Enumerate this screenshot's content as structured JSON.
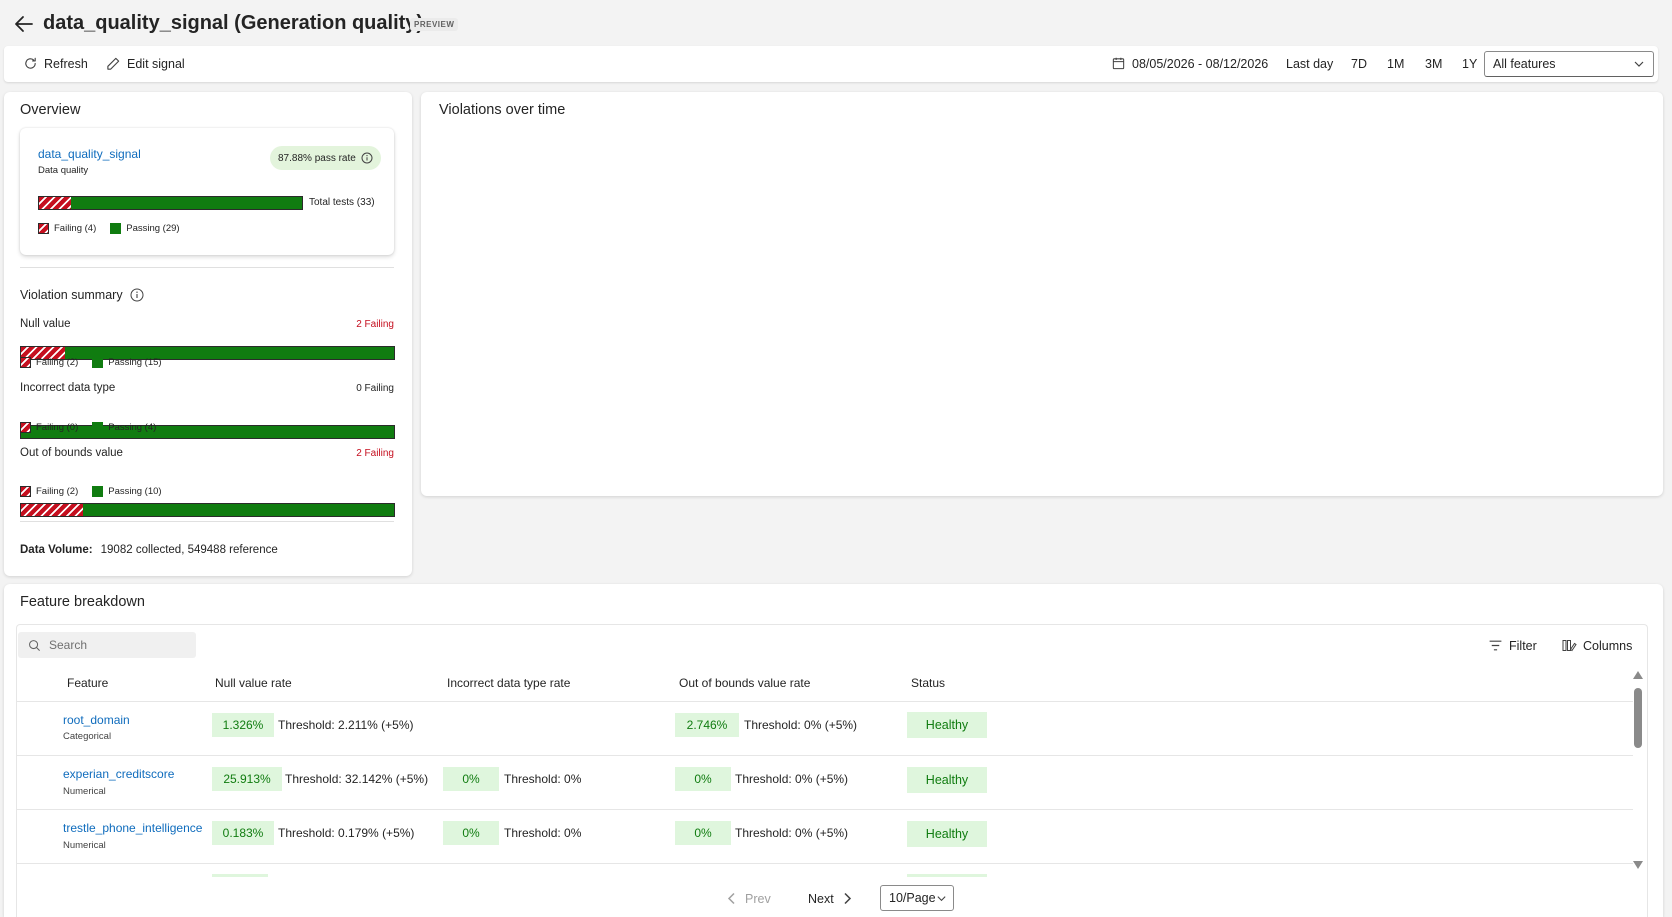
{
  "header": {
    "title": "data_quality_signal (Generation quality)",
    "badge": "PREVIEW"
  },
  "toolbar": {
    "refresh_label": "Refresh",
    "edit_label": "Edit signal",
    "date_range": "08/05/2026 - 08/12/2026",
    "ranges": [
      "Last day",
      "7D",
      "1M",
      "3M",
      "1Y"
    ],
    "feature_filter": "All features"
  },
  "overview": {
    "title": "Overview",
    "signal_name": "data_quality_signal",
    "signal_type": "Data quality",
    "pass_rate_label": "87.88% pass rate",
    "pass_rate": 0.8788,
    "total_tests_label": "Total tests (33)",
    "failing_label": "Failing (4)",
    "passing_label": "Passing (29)",
    "failing": 4,
    "passing": 29
  },
  "violation_summary": {
    "title": "Violation summary",
    "items": [
      {
        "label": "Null value",
        "count_label": "2 Failing",
        "failing_label": "Failing (2)",
        "passing_label": "Passing (15)",
        "failing": 2,
        "passing": 15
      },
      {
        "label": "Incorrect data type",
        "count_label": "0 Failing",
        "failing_label": "Failing (0)",
        "passing_label": "Passing (4)",
        "failing": 0,
        "passing": 4
      },
      {
        "label": "Out of bounds value",
        "count_label": "2 Failing",
        "failing_label": "Failing (2)",
        "passing_label": "Passing (10)",
        "failing": 2,
        "passing": 10
      }
    ]
  },
  "data_volume": {
    "label": "Data Volume:",
    "value": "19082 collected, 549488 reference"
  },
  "violations_over_time": {
    "title": "Violations over time"
  },
  "breakdown": {
    "title": "Feature breakdown",
    "search_placeholder": "Search",
    "filter_label": "Filter",
    "columns_label": "Columns",
    "headers": {
      "feature": "Feature",
      "null_rate": "Null value rate",
      "type_rate": "Incorrect data type rate",
      "oob_rate": "Out of bounds value rate",
      "status": "Status"
    },
    "rows": [
      {
        "name": "root_domain",
        "type": "Categorical",
        "null": "1.326%",
        "null_thr": "Threshold: 2.211% (+5%)",
        "dtype": "",
        "dtype_thr": "",
        "oob": "2.746%",
        "oob_thr": "Threshold: 0% (+5%)",
        "status": "Healthy"
      },
      {
        "name": "experian_creditscore",
        "type": "Numerical",
        "null": "25.913%",
        "null_thr": "Threshold: 32.142% (+5%)",
        "dtype": "0%",
        "dtype_thr": "Threshold: 0%",
        "oob": "0%",
        "oob_thr": "Threshold: 0% (+5%)",
        "status": "Healthy"
      },
      {
        "name": "trestle_phone_intelligence",
        "type": "Numerical",
        "null": "0.183%",
        "null_thr": "Threshold: 0.179% (+5%)",
        "dtype": "0%",
        "dtype_thr": "Threshold: 0%",
        "oob": "0%",
        "oob_thr": "Threshold: 0% (+5%)",
        "status": "Healthy"
      }
    ],
    "pager": {
      "prev": "Prev",
      "next": "Next",
      "page_size": "10/Page"
    }
  },
  "colors": {
    "pass": "#107c10",
    "fail": "#c50f1f",
    "link": "#0f6cbd",
    "healthy_bg": "#dff6dd"
  }
}
